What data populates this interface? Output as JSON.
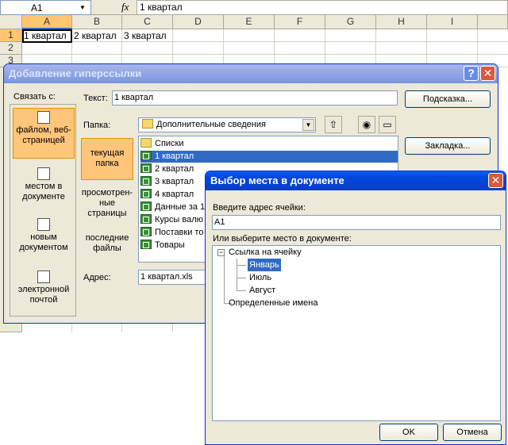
{
  "excel": {
    "namebox": "A1",
    "fx_label": "fx",
    "formula": "1 квартал",
    "columns": [
      "A",
      "B",
      "C",
      "D",
      "E",
      "F",
      "G",
      "H",
      "I"
    ],
    "rows": [
      "1",
      "2",
      "3"
    ],
    "cells": {
      "A1": "1 квартал",
      "B1": "2 квартал",
      "C1": "3 квартал"
    }
  },
  "hyperlink_dialog": {
    "title": "Добавление гиперссылки",
    "link_to_label": "Связать с:",
    "link_options": [
      "файлом, веб-страницей",
      "местом в документе",
      "новым документом",
      "электронной почтой"
    ],
    "text_label": "Текст:",
    "text_value": "1 квартал",
    "tooltip_button": "Подсказка...",
    "folder_label": "Папка:",
    "folder_value": "Дополнительные сведения",
    "bookmark_button": "Закладка...",
    "nav_items": [
      "текущая папка",
      "просмотрен-ные страницы",
      "последние файлы"
    ],
    "files": [
      "Списки",
      "1 квартал",
      "2 квартал",
      "3 квартал",
      "4 квартал",
      "Данные за 1",
      "Курсы валю",
      "Поставки то",
      "Товары"
    ],
    "address_label": "Адрес:",
    "address_value": "1 квартал.xls"
  },
  "place_dialog": {
    "title": "Выбор места в документе",
    "cell_address_label": "Введите адрес ячейки:",
    "cell_address_value": "A1",
    "place_label": "Или выберите место в документе:",
    "tree": {
      "root": "Ссылка на ячейку",
      "children": [
        "Январь",
        "Июль",
        "Август"
      ],
      "defined_names": "Определенные имена"
    },
    "ok_button": "OK",
    "cancel_button": "Отмена"
  },
  "colors": {
    "selection": "#316ac5",
    "active_title": "#0a5fef",
    "header_selected": "#ffc570"
  }
}
